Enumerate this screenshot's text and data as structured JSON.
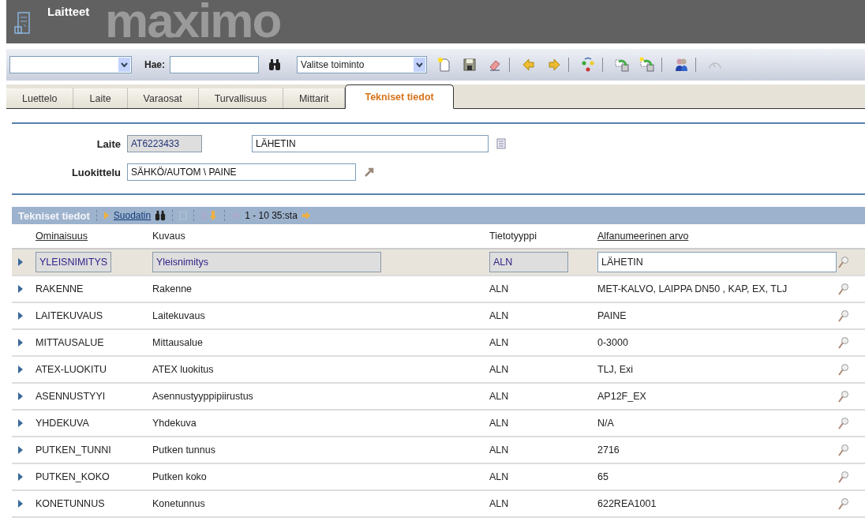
{
  "header": {
    "title": "Laitteet",
    "logo": "maximo"
  },
  "toolbar": {
    "search": {
      "label": "Hae:"
    },
    "action_select": {
      "value": "Valitse toiminto"
    },
    "buttons": [
      {
        "kind": "new",
        "disabled": false
      },
      {
        "kind": "save",
        "disabled": false
      },
      {
        "kind": "erase",
        "disabled": false
      },
      {
        "kind": "sep"
      },
      {
        "kind": "prev",
        "disabled": false
      },
      {
        "kind": "next",
        "disabled": false
      },
      {
        "kind": "sep"
      },
      {
        "kind": "refresh",
        "disabled": false
      },
      {
        "kind": "sep"
      },
      {
        "kind": "move",
        "disabled": false
      },
      {
        "kind": "copymove",
        "disabled": false
      },
      {
        "kind": "sep"
      },
      {
        "kind": "people",
        "disabled": false
      },
      {
        "kind": "sep"
      },
      {
        "kind": "gauge",
        "disabled": true
      }
    ]
  },
  "tabs": [
    {
      "label": "Luettelo",
      "selected": false
    },
    {
      "label": "Laite",
      "selected": false
    },
    {
      "label": "Varaosat",
      "selected": false
    },
    {
      "label": "Turvallisuus",
      "selected": false
    },
    {
      "label": "Mittarit",
      "selected": false
    },
    {
      "label": "Tekniset tiedot",
      "selected": true
    }
  ],
  "form": {
    "laite": {
      "label": "Laite",
      "id": "AT6223433",
      "description": "LÄHETIN"
    },
    "luokittelu": {
      "label": "Luokittelu",
      "value": "SÄHKÖ/AUTOM \\ PAINE"
    }
  },
  "table": {
    "title": "Tekniset tiedot",
    "filter": "Suodatin",
    "paging": "1 - 10 35:sta",
    "columns": [
      {
        "label": "Ominaisuus",
        "underlined": true
      },
      {
        "label": "Kuvaus",
        "underlined": false
      },
      {
        "label": "Tietotyyppi",
        "underlined": false
      },
      {
        "label": "Alfanumeerinen arvo",
        "underlined": true
      }
    ],
    "rows": [
      {
        "selected": true,
        "cells": [
          "YLEISNIMITYS",
          "Yleisnimitys",
          "ALN",
          "LÄHETIN"
        ]
      },
      {
        "selected": false,
        "cells": [
          "RAKENNE",
          "Rakenne",
          "ALN",
          "MET-KALVO, LAIPPA DN50 , KAP, EX, TLJ"
        ]
      },
      {
        "selected": false,
        "cells": [
          "LAITEKUVAUS",
          "Laitekuvaus",
          "ALN",
          "PAINE"
        ]
      },
      {
        "selected": false,
        "cells": [
          "MITTAUSALUE",
          "Mittausalue",
          "ALN",
          "0-3000"
        ]
      },
      {
        "selected": false,
        "cells": [
          "ATEX-LUOKITU",
          "ATEX luokitus",
          "ALN",
          "TLJ, Exi"
        ]
      },
      {
        "selected": false,
        "cells": [
          "ASENNUSTYYI",
          "Asennustyyppipiirustus",
          "ALN",
          "AP12F_EX"
        ]
      },
      {
        "selected": false,
        "cells": [
          "YHDEKUVA",
          "Yhdekuva",
          "ALN",
          "N/A"
        ]
      },
      {
        "selected": false,
        "cells": [
          "PUTKEN_TUNNI",
          "Putken tunnus",
          "ALN",
          "2716"
        ]
      },
      {
        "selected": false,
        "cells": [
          "PUTKEN_KOKO",
          "Putken koko",
          "ALN",
          "65"
        ]
      },
      {
        "selected": false,
        "cells": [
          "KONETUNNUS",
          "Konetunnus",
          "ALN",
          "622REA1001"
        ]
      }
    ]
  }
}
